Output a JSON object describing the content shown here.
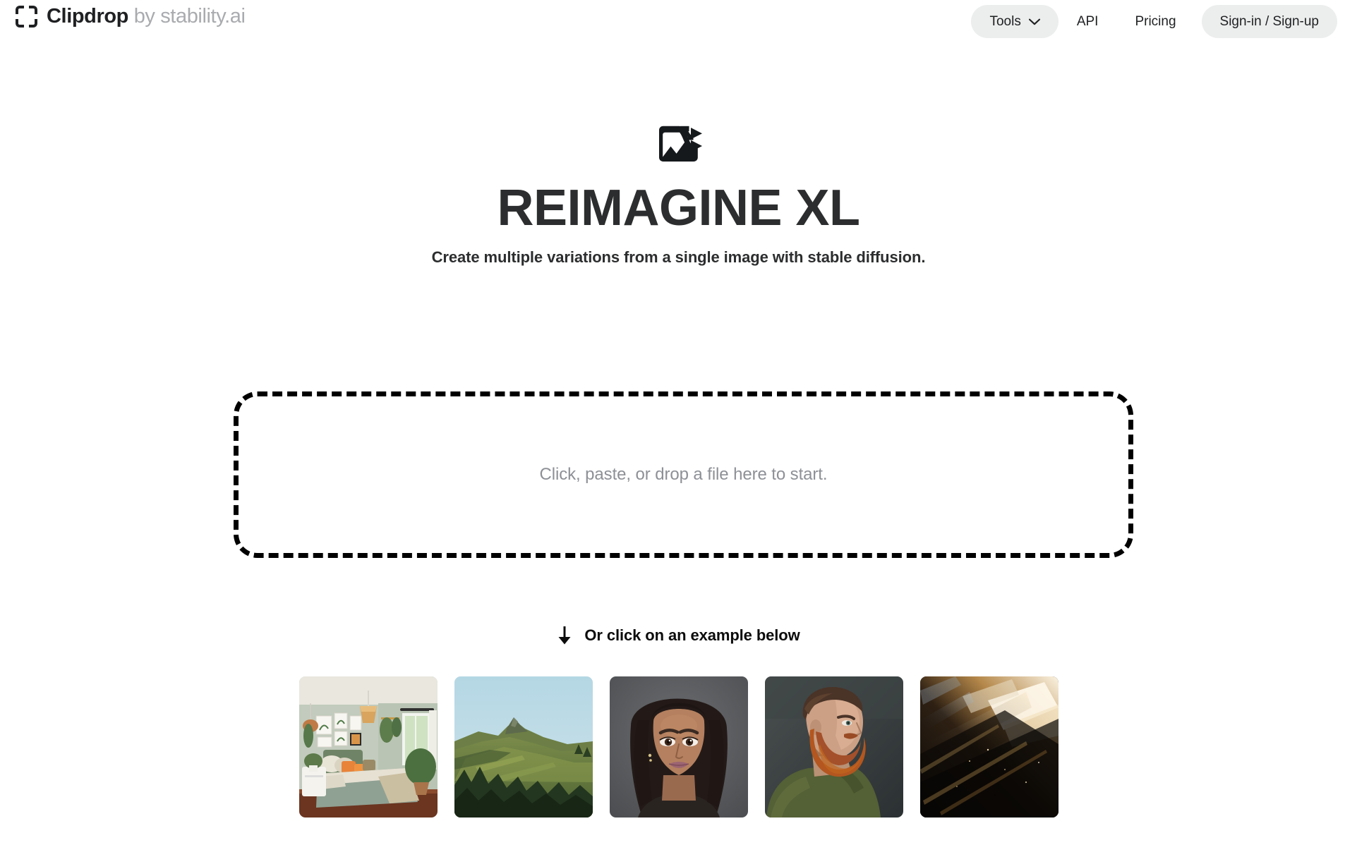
{
  "header": {
    "brand": {
      "icon": "clipdrop-brackets-logo",
      "name": "Clipdrop",
      "by": "by",
      "partner": "stability.ai"
    },
    "nav": [
      {
        "label": "Tools",
        "icon": "chevron-down-icon",
        "style": "filled",
        "name": "nav-tools"
      },
      {
        "label": "API",
        "icon": "",
        "style": "plain",
        "name": "nav-api"
      },
      {
        "label": "Pricing",
        "icon": "",
        "style": "plain",
        "name": "nav-pricing"
      },
      {
        "label": "Sign-in / Sign-up",
        "icon": "",
        "style": "filled",
        "name": "nav-signin-signup"
      }
    ]
  },
  "hero": {
    "icon": "image-shuffle-icon",
    "title": "REIMAGINE XL",
    "subtitle": "Create multiple variations from a single image with stable diffusion."
  },
  "dropzone": {
    "text": "Click, paste, or drop a file here to start.",
    "border_color": "#000000"
  },
  "examples": {
    "arrow_icon": "arrow-down-icon",
    "label": "Or click on an example below",
    "items": [
      {
        "name": "example-bedroom-interior",
        "alt": "Bedroom interior with sage green walls, orange pillows and hanging plants"
      },
      {
        "name": "example-mountain-landscape",
        "alt": "Mountain landscape with pale blue sky, grassy slopes and pine forest"
      },
      {
        "name": "example-woman-portrait",
        "alt": "Portrait of a smiling woman with long dark hair on a grey background"
      },
      {
        "name": "example-bearded-man-portrait",
        "alt": "Bearded man in a green t-shirt looking up, dark background"
      },
      {
        "name": "example-abstract-light-streaks",
        "alt": "Abstract golden light streaks on a dark background"
      }
    ]
  },
  "colors": {
    "text_primary": "#1f2022",
    "text_muted": "#8d9096",
    "pill_background": "#eceded",
    "brand_secondary": "#a9abae"
  }
}
